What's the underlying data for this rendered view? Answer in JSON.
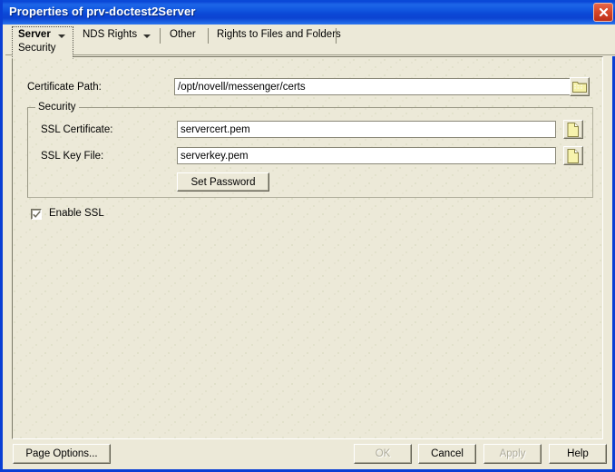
{
  "window": {
    "title": "Properties of prv-doctest2Server",
    "close_icon": "close-icon",
    "accent_color": "#0a46d6",
    "face_color": "#ece9d8"
  },
  "tabs": {
    "active": {
      "line1": "Server",
      "line2": "Security",
      "has_dropdown": true
    },
    "items": [
      {
        "label": "NDS Rights",
        "has_dropdown": true
      },
      {
        "label": "Other",
        "has_dropdown": false
      },
      {
        "label": "Rights to Files and Folders",
        "has_dropdown": false
      }
    ]
  },
  "form": {
    "certificate_path": {
      "label": "Certificate Path:",
      "value": "/opt/novell/messenger/certs",
      "placeholder": "",
      "browse_icon": "folder-icon"
    },
    "security_group": {
      "title": "Security",
      "ssl_certificate": {
        "label": "SSL Certificate:",
        "value": "servercert.pem",
        "placeholder": "",
        "browse_icon": "file-icon"
      },
      "ssl_key_file": {
        "label": "SSL Key File:",
        "value": "serverkey.pem",
        "placeholder": "",
        "browse_icon": "file-icon"
      },
      "set_password_label": "Set Password"
    },
    "enable_ssl": {
      "label": "Enable SSL",
      "checked": true
    }
  },
  "footer": {
    "page_options_label": "Page Options...",
    "ok_label": "OK",
    "cancel_label": "Cancel",
    "apply_label": "Apply",
    "help_label": "Help",
    "ok_enabled": false,
    "cancel_enabled": true,
    "apply_enabled": false,
    "help_enabled": true
  }
}
